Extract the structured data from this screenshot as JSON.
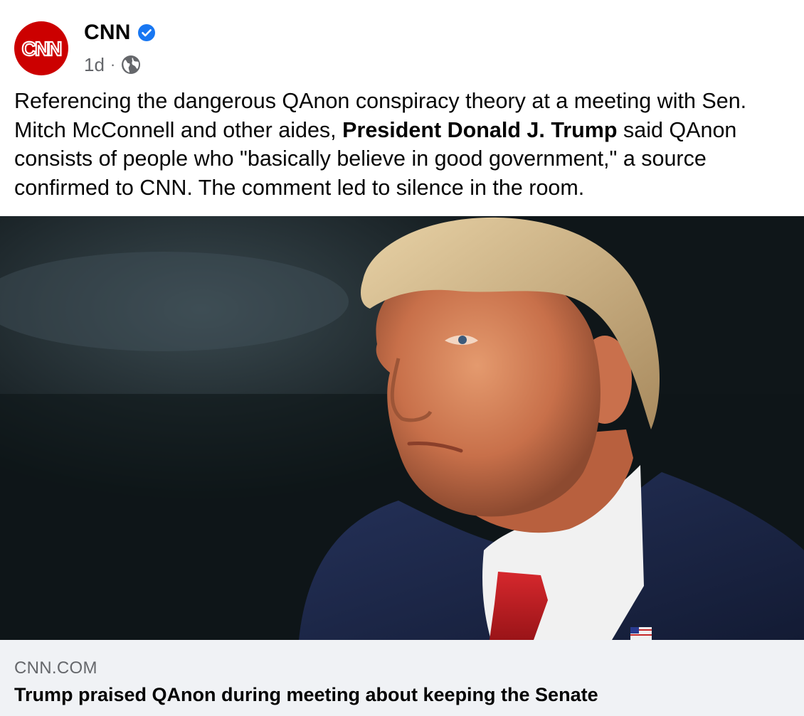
{
  "post": {
    "page_name": "CNN",
    "verified_icon": "verified-badge-icon",
    "timestamp": "1d",
    "separator": "·",
    "audience_icon": "globe-icon",
    "avatar": {
      "logo_text": "CNN",
      "background_color": "#cc0000"
    },
    "caption": {
      "part1": "Referencing the dangerous QAnon conspiracy theory at a meeting with Sen. Mitch McConnell and other aides, ",
      "bold": "President Donald J. Trump",
      "part2": " said QAnon consists of people who \"basically believe in good government,\" a source confirmed to CNN. The comment led to silence in the room."
    },
    "image": {
      "subject": "portrait photo of Donald J. Trump in navy suit and red tie against dark background"
    },
    "link_preview": {
      "domain": "CNN.COM",
      "title": "Trump praised QAnon during meeting about keeping the Senate",
      "background_color": "#f0f2f5"
    }
  },
  "colors": {
    "verified_blue": "#1877f2",
    "secondary_text": "#65676b",
    "primary_text": "#050505"
  }
}
